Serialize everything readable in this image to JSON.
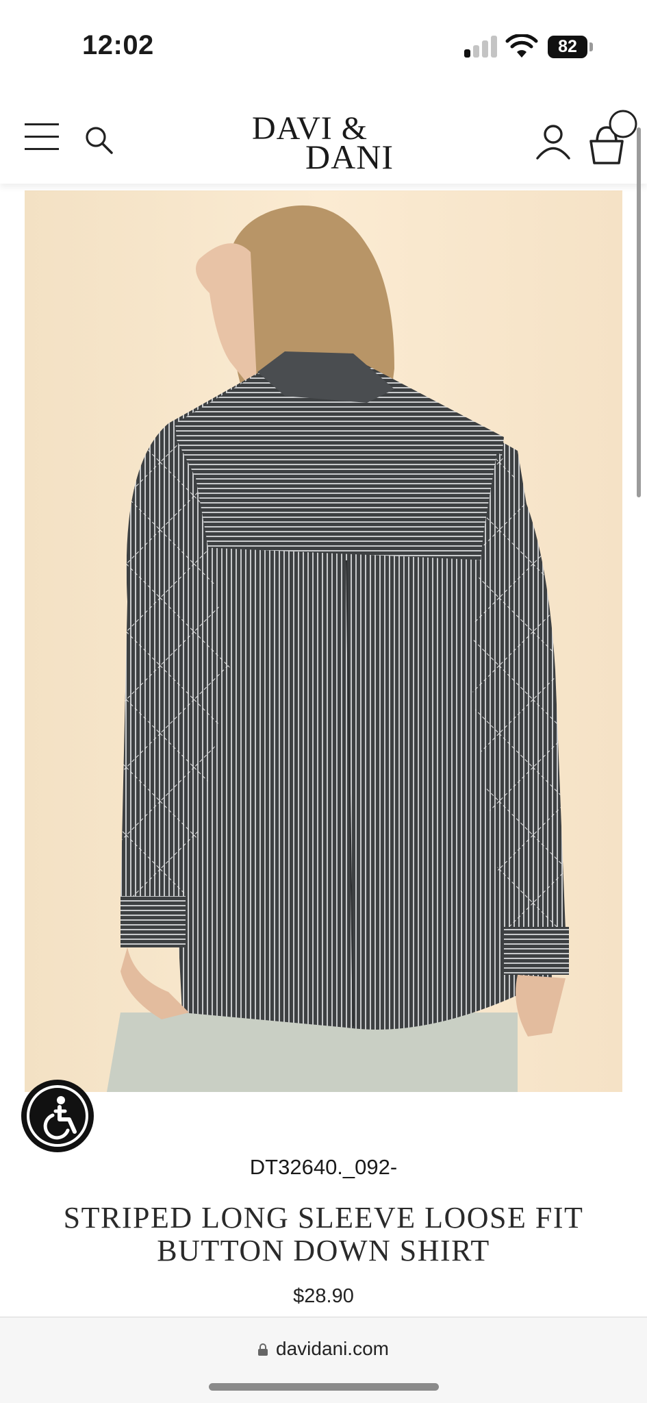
{
  "status_bar": {
    "time": "12:02",
    "battery": "82"
  },
  "header": {
    "logo_line1": "DAVI &",
    "logo_line2": "DANI"
  },
  "product": {
    "sku": "DT32640._092-",
    "title": "STRIPED LONG SLEEVE LOOSE FIT BUTTON DOWN SHIRT",
    "price": "$28.90"
  },
  "browser": {
    "url": "davidani.com"
  },
  "icons": {
    "menu": "hamburger-icon",
    "search": "search-icon",
    "account": "user-icon",
    "cart": "shopping-bag-icon",
    "accessibility": "accessibility-icon",
    "lock": "lock-icon"
  }
}
